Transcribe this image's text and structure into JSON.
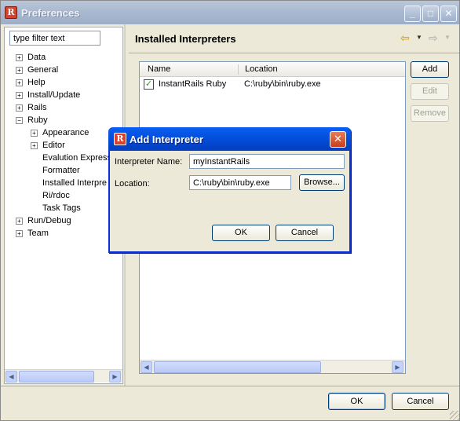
{
  "window": {
    "title": "Preferences",
    "app_icon": "ruby-app-icon"
  },
  "filter": {
    "value": "type filter text"
  },
  "tree": [
    {
      "label": "Data",
      "expander": "+",
      "level": 0
    },
    {
      "label": "General",
      "expander": "+",
      "level": 0
    },
    {
      "label": "Help",
      "expander": "+",
      "level": 0
    },
    {
      "label": "Install/Update",
      "expander": "+",
      "level": 0
    },
    {
      "label": "Rails",
      "expander": "+",
      "level": 0
    },
    {
      "label": "Ruby",
      "expander": "−",
      "level": 0
    },
    {
      "label": "Appearance",
      "expander": "+",
      "level": 1
    },
    {
      "label": "Editor",
      "expander": "+",
      "level": 1
    },
    {
      "label": "Evalution Express",
      "expander": "",
      "level": 1
    },
    {
      "label": "Formatter",
      "expander": "",
      "level": 1
    },
    {
      "label": "Installed Interpre",
      "expander": "",
      "level": 1
    },
    {
      "label": "Ri/rdoc",
      "expander": "",
      "level": 1
    },
    {
      "label": "Task Tags",
      "expander": "",
      "level": 1
    },
    {
      "label": "Run/Debug",
      "expander": "+",
      "level": 0
    },
    {
      "label": "Team",
      "expander": "+",
      "level": 0
    }
  ],
  "page": {
    "title": "Installed Interpreters",
    "columns": [
      "Name",
      "Location"
    ],
    "rows": [
      {
        "name": "InstantRails Ruby",
        "location": "C:\\ruby\\bin\\ruby.exe",
        "checked": true
      }
    ],
    "buttons": {
      "add": "Add",
      "edit": "Edit",
      "remove": "Remove"
    }
  },
  "footer": {
    "ok": "OK",
    "cancel": "Cancel"
  },
  "dialog": {
    "title": "Add Interpreter",
    "name_label": "Interpreter Name:",
    "name_value": "myInstantRails",
    "location_label": "Location:",
    "location_value": "C:\\ruby\\bin\\ruby.exe",
    "browse": "Browse...",
    "ok": "OK",
    "cancel": "Cancel"
  },
  "colors": {
    "accent": "#0550de",
    "title_inactive": "#a9b8cf",
    "close": "#c93e1c"
  }
}
